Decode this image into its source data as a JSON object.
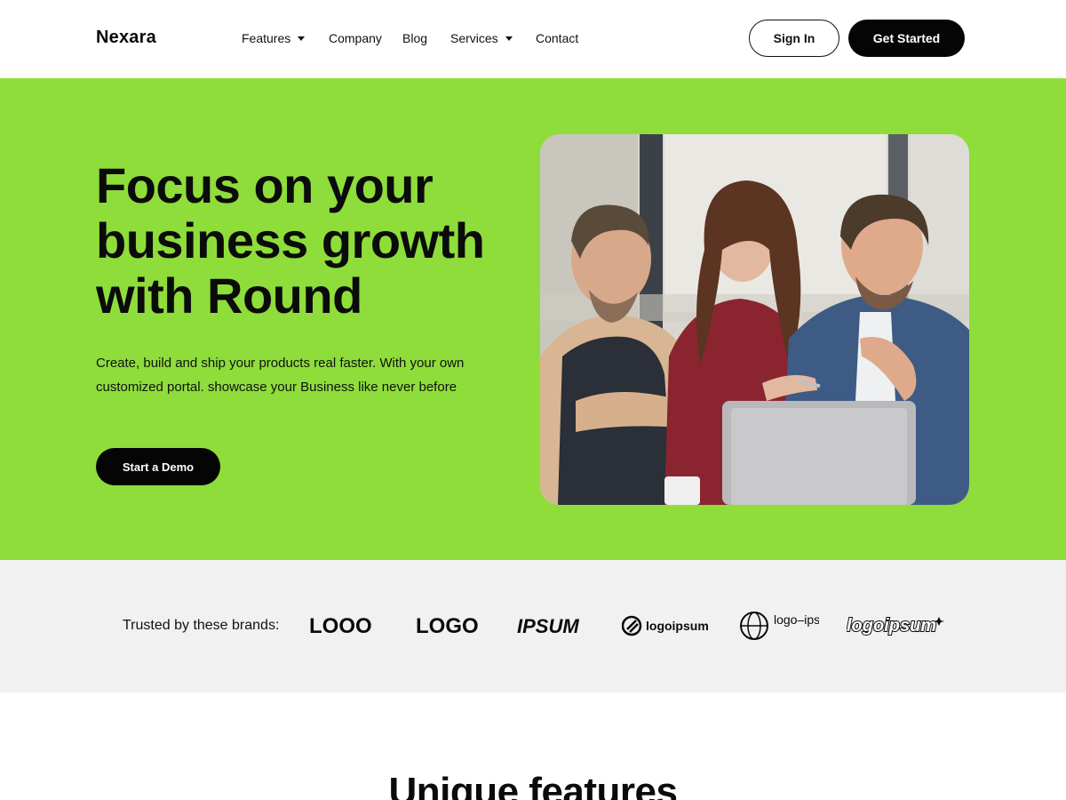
{
  "nav": {
    "brand": "Nexara",
    "items": [
      {
        "label": "Features",
        "dropdown": true
      },
      {
        "label": "Company",
        "dropdown": false
      },
      {
        "label": "Blog",
        "dropdown": false
      },
      {
        "label": "Services",
        "dropdown": true
      },
      {
        "label": "Contact",
        "dropdown": false
      }
    ],
    "sign_in": "Sign In",
    "get_started": "Get Started"
  },
  "hero": {
    "title": "Focus on your business growth with Round",
    "description": "Create, build and ship your products real faster. With your own customized portal. showcase your Business like never before",
    "cta": "Start a Demo",
    "photo": "team-meeting-photo"
  },
  "trusted": {
    "label": "Trusted by these brands:",
    "logos": [
      "LOOO",
      "LOGO",
      "IPSUM",
      "logoipsum",
      "logo–ipsum",
      "logoipsum"
    ]
  },
  "features": {
    "title": "Unique features"
  },
  "colors": {
    "hero_bg": "#8edd3a",
    "trusted_bg": "#f1f1f1",
    "button_dark": "#050505"
  }
}
